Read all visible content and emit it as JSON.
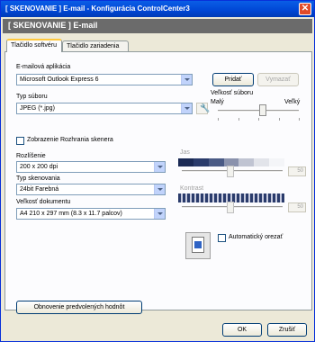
{
  "window": {
    "title": "[ SKENOVANIE ] E-mail - Konfigurácia ControlCenter3"
  },
  "banner": {
    "text": "[ SKENOVANIE ] E-mail"
  },
  "tabs": [
    {
      "label": "Tlačidlo softvéru"
    },
    {
      "label": "Tlačidlo zariadenia"
    }
  ],
  "email": {
    "label": "E-mailová aplikácia",
    "value": "Microsoft Outlook Express 6",
    "add": "Pridať",
    "remove": "Vymazať"
  },
  "file_type": {
    "label": "Typ súboru",
    "value": "JPEG (*.jpg)"
  },
  "file_size": {
    "label": "Veľkosť súboru",
    "min": "Malý",
    "max": "Veľký",
    "level": 0.55
  },
  "show_scanner": {
    "label": "Zobrazenie Rozhrania skenera",
    "checked": false
  },
  "resolution": {
    "label": "Rozlíšenie",
    "value": "200 x 200 dpi"
  },
  "scan_type": {
    "label": "Typ skenovania",
    "value": "24bit Farebná"
  },
  "doc_size": {
    "label": "Veľkosť dokumentu",
    "value": "A4 210 x 297 mm (8.3 x 11.7 palcov)"
  },
  "brightness": {
    "label": "Jas",
    "value": "50"
  },
  "contrast": {
    "label": "Kontrast",
    "value": "50"
  },
  "auto_crop": {
    "label": "Automatický orezať",
    "checked": false
  },
  "restore": {
    "label": "Obnovenie predvolených hodnôt"
  },
  "footer": {
    "ok": "OK",
    "cancel": "Zrušiť"
  }
}
